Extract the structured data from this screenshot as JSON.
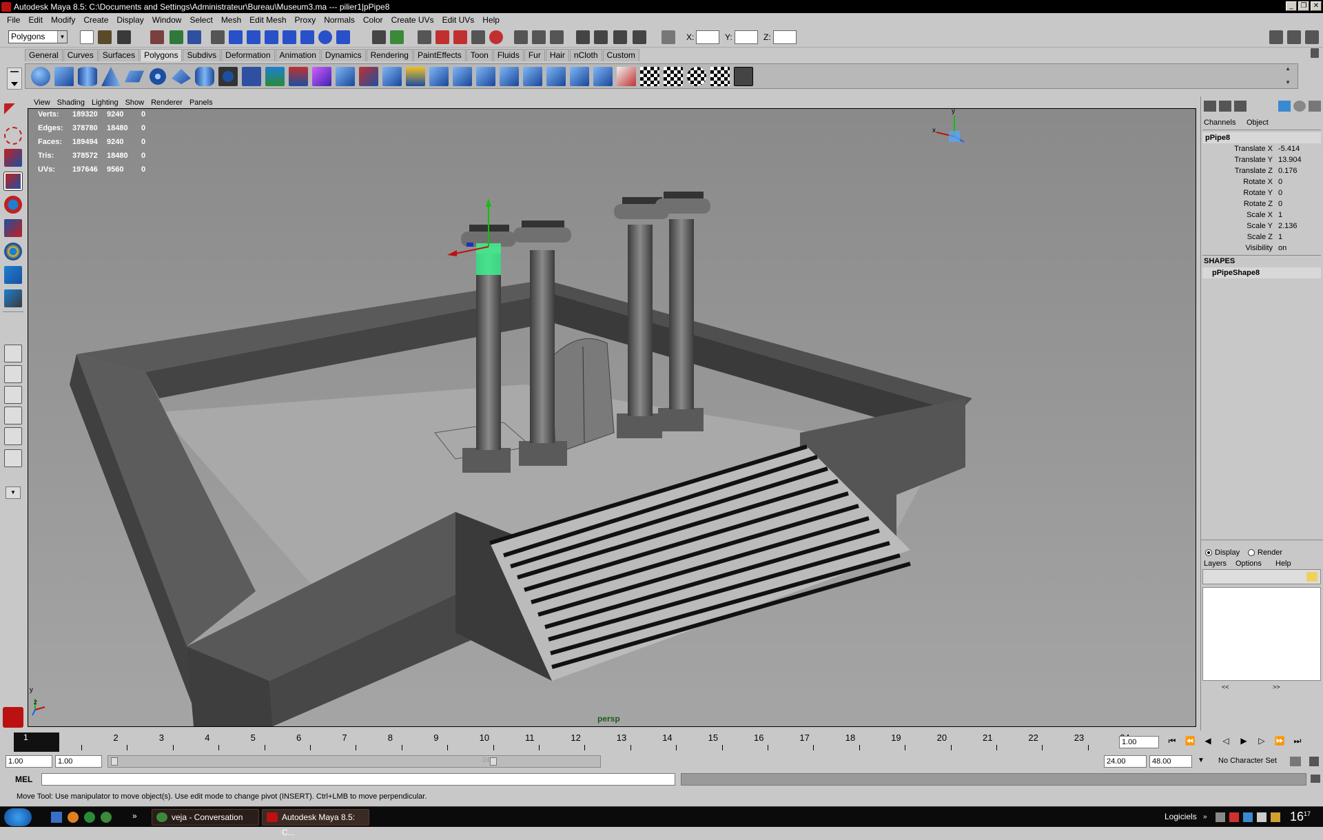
{
  "window": {
    "title": "Autodesk Maya 8.5: C:\\Documents and Settings\\Administrateur\\Bureau\\Museum3.ma   ---   pilier1|pPipe8",
    "controls": [
      "_",
      "❐",
      "✕"
    ]
  },
  "menubar": [
    "File",
    "Edit",
    "Modify",
    "Create",
    "Display",
    "Window",
    "Select",
    "Mesh",
    "Edit Mesh",
    "Proxy",
    "Normals",
    "Color",
    "Create UVs",
    "Edit UVs",
    "Help"
  ],
  "statusline": {
    "mode": "Polygons",
    "x_label": "X:",
    "y_label": "Y:",
    "z_label": "Z:"
  },
  "shelf": {
    "tabs": [
      "General",
      "Curves",
      "Surfaces",
      "Polygons",
      "Subdivs",
      "Deformation",
      "Animation",
      "Dynamics",
      "Rendering",
      "PaintEffects",
      "Toon",
      "Fluids",
      "Fur",
      "Hair",
      "nCloth",
      "Custom"
    ],
    "active": "Polygons"
  },
  "viewport": {
    "menu": [
      "View",
      "Shading",
      "Lighting",
      "Show",
      "Renderer",
      "Panels"
    ],
    "hud": [
      {
        "label": "Verts:",
        "a": "189320",
        "b": "9240",
        "c": "0"
      },
      {
        "label": "Edges:",
        "a": "378780",
        "b": "18480",
        "c": "0"
      },
      {
        "label": "Faces:",
        "a": "189494",
        "b": "9240",
        "c": "0"
      },
      {
        "label": "Tris:",
        "a": "378572",
        "b": "18480",
        "c": "0"
      },
      {
        "label": "UVs:",
        "a": "197646",
        "b": "9560",
        "c": "0"
      }
    ],
    "camera": "persp",
    "axis_labels": {
      "y": "y",
      "x": "x",
      "z": "z"
    }
  },
  "channelbox": {
    "tabs": [
      "Channels",
      "Object"
    ],
    "object": "pPipe8",
    "channels": [
      {
        "label": "Translate X",
        "value": "-5.414"
      },
      {
        "label": "Translate Y",
        "value": "13.904"
      },
      {
        "label": "Translate Z",
        "value": "0.176"
      },
      {
        "label": "Rotate X",
        "value": "0"
      },
      {
        "label": "Rotate Y",
        "value": "0"
      },
      {
        "label": "Rotate Z",
        "value": "0"
      },
      {
        "label": "Scale X",
        "value": "1"
      },
      {
        "label": "Scale Y",
        "value": "2.136"
      },
      {
        "label": "Scale Z",
        "value": "1"
      },
      {
        "label": "Visibility",
        "value": "on"
      }
    ],
    "shapes_header": "SHAPES",
    "shape": "pPipeShape8"
  },
  "layers": {
    "display_label": "Display",
    "render_label": "Render",
    "menu": [
      "Layers",
      "Options",
      "Help"
    ],
    "selected": "Display",
    "scroll": [
      "<<",
      ">>"
    ]
  },
  "timeline": {
    "frames": [
      "1",
      "2",
      "3",
      "4",
      "5",
      "6",
      "7",
      "8",
      "9",
      "10",
      "11",
      "12",
      "13",
      "14",
      "15",
      "16",
      "17",
      "18",
      "19",
      "20",
      "21",
      "22",
      "23",
      "24"
    ],
    "current_frame": "1.00",
    "current_marker": "1"
  },
  "range": {
    "start": "1.00",
    "anim_start": "1.00",
    "end": "24.00",
    "anim_end": "48.00",
    "slider_label": "24",
    "char_set": "No Character Set"
  },
  "mel": {
    "label": "MEL"
  },
  "helpline": "Move Tool: Use manipulator to move object(s). Use edit mode to change pivot (INSERT).  Ctrl+LMB to move perpendicular.",
  "taskbar": {
    "tasks": [
      "veja - Conversation",
      "Autodesk Maya 8.5: C..."
    ],
    "tray_label": "Logiciels",
    "clock": "16",
    "clock_min": "17"
  },
  "colors": {
    "accent": "#0a246a",
    "selection": "#3ef08e",
    "maya_red": "#b11"
  }
}
